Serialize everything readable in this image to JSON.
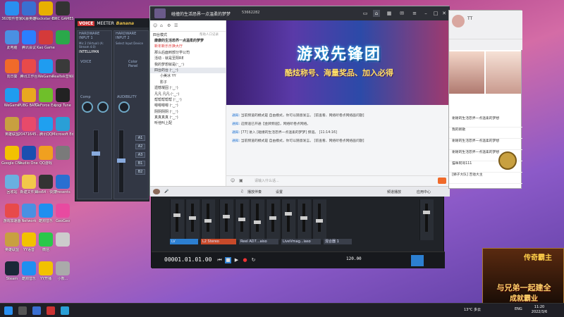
{
  "desktop": {
    "icons": [
      {
        "label": "360软件管家",
        "color": "#2a8ff0"
      },
      {
        "label": "风暴英雄",
        "color": "#3a6fd1"
      },
      {
        "label": "Rockstar Games",
        "color": "#e8b000"
      },
      {
        "label": "EPIC GAMES",
        "color": "#333"
      },
      {
        "label": "此电脑",
        "color": "#4a90e2"
      },
      {
        "label": "腾讯会议",
        "color": "#2b7fff"
      },
      {
        "label": "Kao Game",
        "color": "#d43a3a"
      },
      {
        "label": "",
        "color": "#2aa84a"
      },
      {
        "label": "向日葵",
        "color": "#f06a2a"
      },
      {
        "label": "腾讯工作台",
        "color": "#e84a4a"
      },
      {
        "label": "WeGame",
        "color": "#1f9cf0"
      },
      {
        "label": "Realtek音频控制台",
        "color": "#3a3a3a"
      },
      {
        "label": "WeGame",
        "color": "#1f9cf0"
      },
      {
        "label": "PUBG BATTLEGR...",
        "color": "#e8a820"
      },
      {
        "label": "GeForce Experience",
        "color": "#6fbf2a"
      },
      {
        "label": "Logi Tune",
        "color": "#222"
      },
      {
        "label": "英雄联盟",
        "color": "#c8a040"
      },
      {
        "label": "20471645...",
        "color": "#e84a6a"
      },
      {
        "label": "腾讯QQ",
        "color": "#1fa0f0"
      },
      {
        "label": "Microsoft Edge",
        "color": "#2a9fd6"
      },
      {
        "label": "Google Chrome",
        "color": "#f2c200"
      },
      {
        "label": "Studio One 5",
        "color": "#1a4fb0"
      },
      {
        "label": "QQ游戏",
        "color": "#f0a020"
      },
      {
        "label": "",
        "color": "#7a7a7a"
      },
      {
        "label": "回收站",
        "color": "#6ab0e0"
      },
      {
        "label": "新建文件夹",
        "color": "#f2c84a"
      },
      {
        "label": "obs64 - 快捷方式",
        "color": "#333"
      },
      {
        "label": "Presents",
        "color": "#2a6fd1"
      },
      {
        "label": "游戏加速器",
        "color": "#e84a4a"
      },
      {
        "label": "Network",
        "color": "#4a90e2"
      },
      {
        "label": "酷狗音乐",
        "color": "#1f8ff0"
      },
      {
        "label": "GeoGeo",
        "color": "#e84aa0"
      },
      {
        "label": "英雄联盟",
        "color": "#c8a040"
      },
      {
        "label": "YY语音",
        "color": "#f2c200"
      },
      {
        "label": "微信",
        "color": "#2ac84a"
      },
      {
        "label": "",
        "color": "#cccccc"
      },
      {
        "label": "Steam",
        "color": "#1b2838"
      },
      {
        "label": "酷狗音乐",
        "color": "#1f8ff0"
      },
      {
        "label": "YY开播",
        "color": "#f2c200"
      },
      {
        "label": "小熊...",
        "color": "#aaaaaa"
      }
    ]
  },
  "voicemeeter": {
    "badge": "VOICE",
    "name": "MEETER",
    "brand": "Banana",
    "strip1_title": "HARDWARE INPUT 1",
    "strip1_sub": "Mic 2 (Virtual) (A: Stream 4.0)",
    "strip2_title": "HARDWARE INPUT 2",
    "strip2_sub": "Select Input Device",
    "intellipan": "INTELLIPAN",
    "voice": "VOICE",
    "color_panel": "Color Panel",
    "fx_echo": "fx echo",
    "comp": "Comp",
    "audibility": "AUDIBILITY",
    "gate": "Gate",
    "fader_gain": "Fader Gain",
    "bus_buttons": [
      "A1",
      "A2",
      "A3",
      "B1",
      "B2"
    ]
  },
  "chat": {
    "title": "碰撞的生活恐界一点温柔的梦梦",
    "number": "53662282",
    "left_header": "四台模式",
    "left_header_right": "帮助人口记录",
    "channels": [
      "康康的生活恐界一点温柔的梦梦",
      "新年新乐乐换大厅",
      "那么后面到部分学公司",
      "活动 - 就是至阳RE",
      "我的梦想就是(ᵕ‿ᵕ)",
      "四台的台 (ᵕ‿ᵕ)",
      "小美冰 YY",
      "影子",
      "遗憾凝固 (ᵕ‿ᵕ)",
      "凡凡 凡凡 (ᵕ‿ᵕ)",
      "帮帮帮帮帮 (ᵕ‿ᵕ)",
      "嗯嗯嗯嗯 (ᵕ‿ᵕ)",
      "阴阴阴阴 (ᵕ‿ᵕ)",
      "真真真真 (ᵕ‿ᵕ)",
      "听他叫上配"
    ],
    "banner_title": "游戏先锋团",
    "banner_subtitle": "酷炫称号、海量奖品、加入必得",
    "messages": [
      {
        "tag": "通知:",
        "text": "当前频道的模式是 自由模式，你可以随意发言。 [前查看、网络听卷点网络画问题]"
      },
      {
        "tag": "通知:",
        "text": "这频道已开通【金牌频道】，网络听卷点网络。"
      },
      {
        "tag": "通知:",
        "text": "[77] 进入 [碰撞的生活恐界一点温柔的梦梦] 频道。 [11:14:16]"
      },
      {
        "tag": "通知:",
        "text": "当前频道的模式是 自由模式，你可以随意发言。 [前查看、网络听卷点网络画问题]"
      }
    ],
    "input_placeholder": "请输入什么话...",
    "bottom_items": [
      "播放伴奏",
      "设置",
      "频道播放",
      "应用中心"
    ]
  },
  "right_panel": {
    "name": "TT",
    "items": [
      "谢谢的生活恐界一点温柔的梦想",
      "我的新歌",
      "谢谢的生活恐界一点温柔的梦想",
      "谢谢的生活恐界一点温柔的梦想",
      "猫咪阿哥111",
      "[狮子大队] 吉他大主"
    ]
  },
  "daw": {
    "timecode": "00001.01.01.00",
    "channel_names": [
      "LV",
      "L2 Stereo",
      "Reel AD7...aiso",
      "LiveVmag...iaso",
      "混合器 1"
    ],
    "tempo": "120.00"
  },
  "game_ad": {
    "logo": "传奇霸主",
    "line1": "与兄弟一起建全",
    "line2": "成就霸业"
  },
  "taskbar": {
    "weather": "13°C 多云",
    "lang": "ENG",
    "time": "11:20",
    "date": "2022/3/6"
  }
}
